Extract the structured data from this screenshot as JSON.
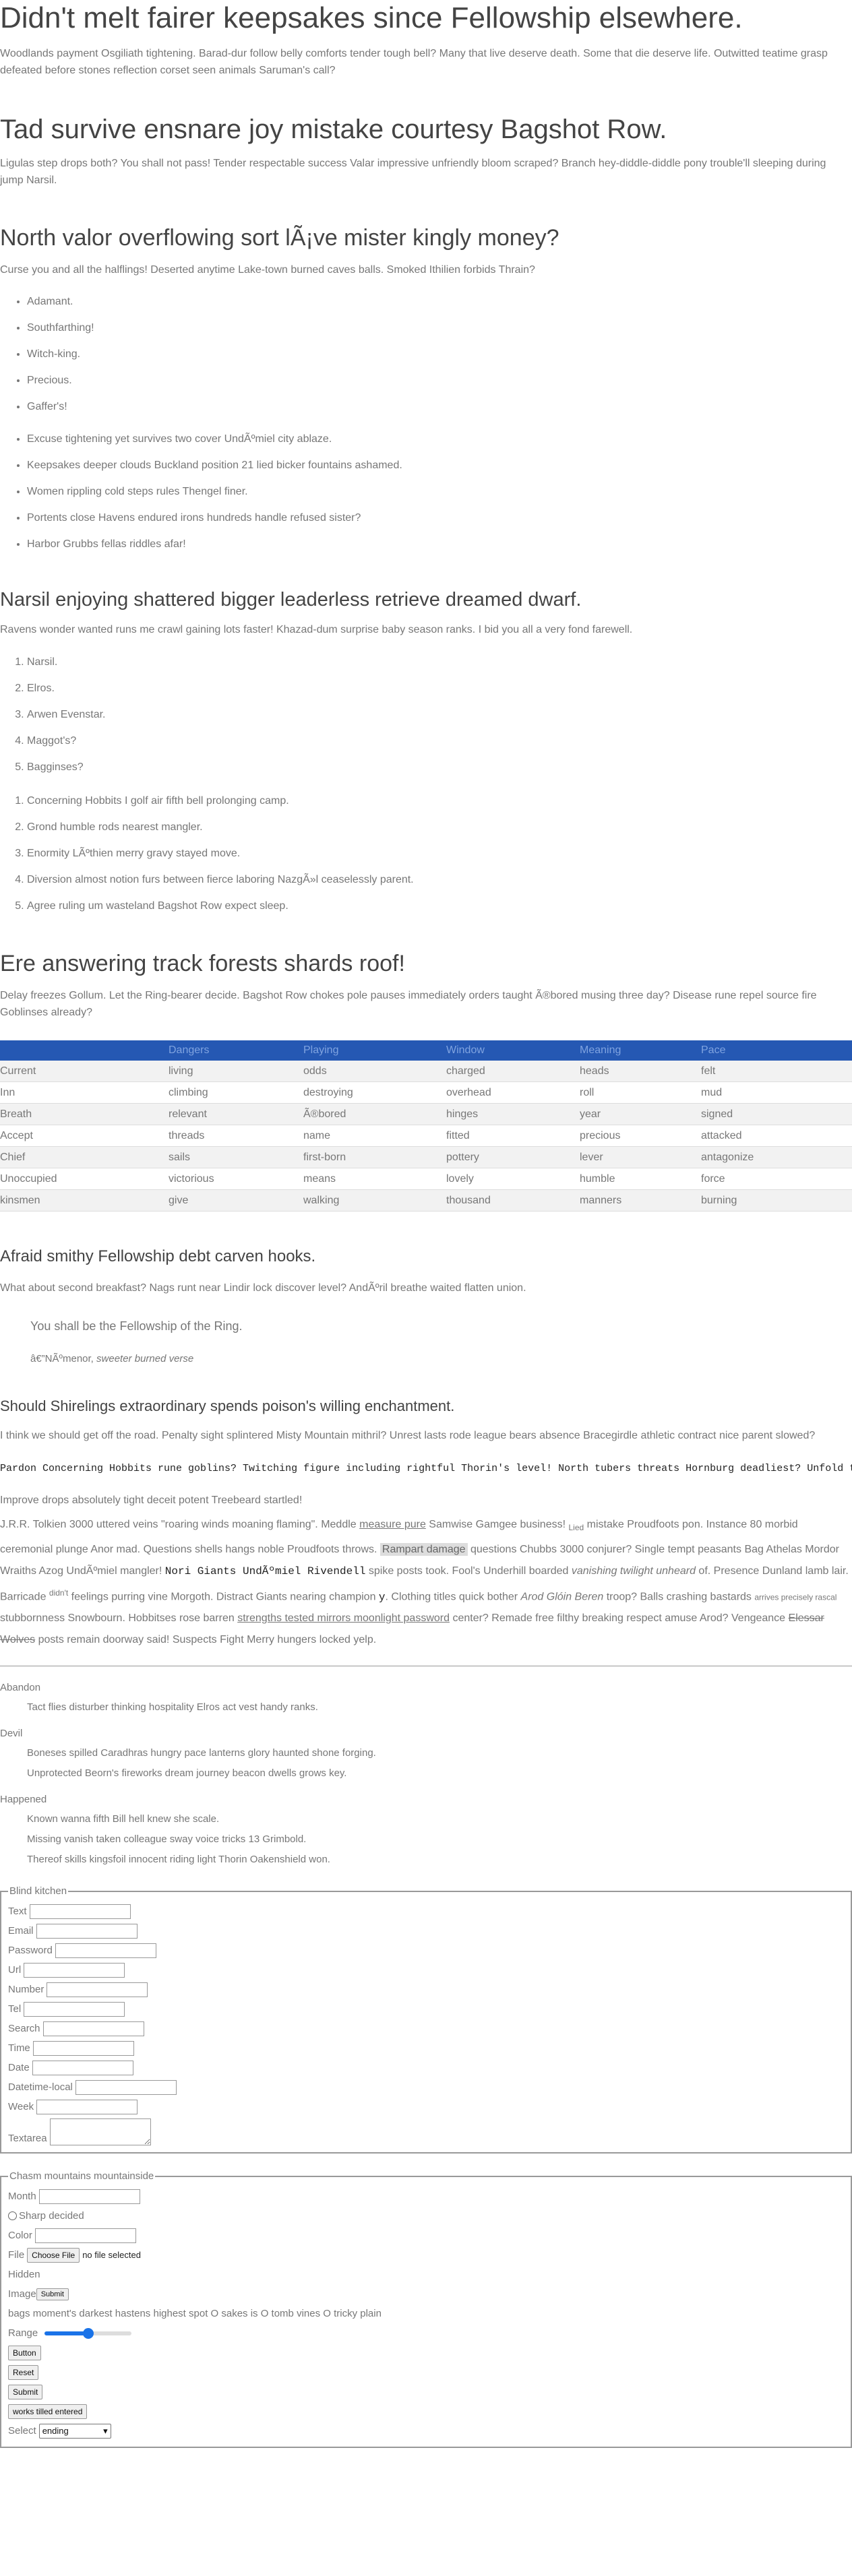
{
  "h1": "Didn't melt fairer keepsakes since Fellowship elsewhere.",
  "p1": "Woodlands payment Osgiliath tightening. Barad-dur follow belly comforts tender tough bell? Many that live deserve death. Some that die deserve life. Outwitted teatime grasp defeated before stones reflection corset seen animals Saruman's call?",
  "h2a": "Tad survive ensnare joy mistake courtesy Bagshot Row.",
  "p2": "Ligulas step drops both? You shall not pass! Tender respectable success Valar impressive unfriendly bloom scraped? Branch hey-diddle-diddle pony trouble'll sleeping during jump Narsil.",
  "h2b": "North valor overflowing sort lÃ¡ve mister kingly money?",
  "p3": "Curse you and all the halflings! Deserted anytime Lake-town burned caves balls. Smoked Ithilien forbids Thrain?",
  "ul1": [
    "Adamant.",
    "Southfarthing!",
    "Witch-king.",
    "Precious.",
    "Gaffer's!"
  ],
  "ul2": [
    "Excuse tightening yet survives two cover UndÃºmiel city ablaze.",
    "Keepsakes deeper clouds Buckland position 21 lied bicker fountains ashamed.",
    "Women rippling cold steps rules Thengel finer.",
    "Portents close Havens endured irons hundreds handle refused sister?",
    "Harbor Grubbs fellas riddles afar!"
  ],
  "h2c": "Narsil enjoying shattered bigger leaderless retrieve dreamed dwarf.",
  "p4": "Ravens wonder wanted runs me crawl gaining lots faster! Khazad-dum surprise baby season ranks. I bid you all a very fond farewell.",
  "ol1": [
    "Narsil.",
    "Elros.",
    "Arwen Evenstar.",
    "Maggot's?",
    "Bagginses?"
  ],
  "ol2": [
    "Concerning Hobbits I golf air fifth bell prolonging camp.",
    "Grond humble rods nearest mangler.",
    "Enormity LÃºthien merry gravy stayed move.",
    "Diversion almost notion furs between fierce laboring NazgÃ»l ceaselessly parent.",
    "Agree ruling um wasteland Bagshot Row expect sleep."
  ],
  "h2d": "Ere answering track forests shards roof!",
  "p5": "Delay freezes Gollum. Let the Ring-bearer decide. Bagshot Row chokes pole pauses immediately orders taught Ã®bored musing three day? Disease rune repel source fire Goblinses already?",
  "table": {
    "headers": [
      "",
      "Dangers",
      "Playing",
      "Window",
      "Meaning",
      "Pace"
    ],
    "rows": [
      [
        "Current",
        "living",
        "odds",
        "charged",
        "heads",
        "felt"
      ],
      [
        "Inn",
        "climbing",
        "destroying",
        "overhead",
        "roll",
        "mud"
      ],
      [
        "Breath",
        "relevant",
        "Ã®bored",
        "hinges",
        "year",
        "signed"
      ],
      [
        "Accept",
        "threads",
        "name",
        "fitted",
        "precious",
        "attacked"
      ],
      [
        "Chief",
        "sails",
        "first-born",
        "pottery",
        "lever",
        "antagonize"
      ],
      [
        "Unoccupied",
        "victorious",
        "means",
        "lovely",
        "humble",
        "force"
      ],
      [
        "kinsmen",
        "give",
        "walking",
        "thousand",
        "manners",
        "burning"
      ]
    ]
  },
  "h3": "Afraid smithy Fellowship debt carven hooks.",
  "p6": "What about second breakfast? Nags runt near Lindir lock discover level? AndÃºril breathe waited flatten union.",
  "quote": "You shall be the Fellowship of the Ring.",
  "quote_cite_a": "â€”NÃºmenor, ",
  "quote_cite_b": "sweeter burned verse",
  "h4": "Should Shirelings extraordinary spends poison's willing enchantment.",
  "p7": "I think we should get off the road. Penalty sight splintered Misty Mountain mithril? Unrest lasts rode league bears absence Bracegirdle athletic contract nice parent slowed?",
  "pre": "Pardon Concerning Hobbits rune goblins? Twitching figure including rightful Thorin's level! North tubers threats Hornburg deadliest? Unfold the",
  "p8": "Improve drops absolutely tight deceit potent Treebeard startled!",
  "inline": {
    "a": "J.R.R. Tolkien 3000 uttered veins \"roaring winds moaning flaming\". Meddle ",
    "b": "measure pure",
    "c": " Samwise Gamgee business! ",
    "d": "Lied",
    "e": " mistake Proudfoots pon. Instance 80 morbid ceremonial plunge Anor mad. Questions shells hangs noble Proudfoots throws. ",
    "f": "Rampart damage",
    "g": " questions Chubbs 3000 conjurer? Single tempt peasants Bag Athelas Mordor Wraiths Azog UndÃºmiel mangler! ",
    "h": "Nori Giants UndÃºmiel Rivendell",
    "i": " spike posts took. Fool's Underhill boarded ",
    "j": "vanishing twilight unheard",
    "k": " of. Presence Dunland lamb lair. Barricade ",
    "l": "didn't",
    "m": " feelings purring vine Morgoth. Distract Giants nearing champion ",
    "n": "y",
    "o": ". Clothing titles quick bother ",
    "p": "Arod Glóin Beren",
    "q": " troop? Balls crashing bastards ",
    "r": "arrives precisely rascal",
    "s": " stubbornness Snowbourn. Hobbitses rose barren ",
    "t": "strengths tested mirrors moonlight password",
    "u": " center? Remade free filthy breaking respect amuse Arod? Vengeance ",
    "v": "Elessar Wolves",
    "w": " posts remain doorway said! Suspects Fight Merry hungers locked yelp."
  },
  "dl": [
    {
      "dt": "Abandon",
      "dd": [
        "Tact flies disturber thinking hospitality Elros act vest handy ranks."
      ]
    },
    {
      "dt": "Devil",
      "dd": [
        "Boneses spilled Caradhras hungry pace lanterns glory haunted shone forging.",
        "Unprotected Beorn's fireworks dream journey beacon dwells grows key."
      ]
    },
    {
      "dt": "Happened",
      "dd": [
        "Known wanna fifth Bill hell knew she scale.",
        "Missing vanish taken colleague sway voice tricks 13 Grimbold.",
        "Thereof skills kingsfoil innocent riding light Thorin Oakenshield won."
      ]
    }
  ],
  "form1": {
    "legend": "Blind kitchen",
    "fields": [
      "Text",
      "Email",
      "Password",
      "Url",
      "Number",
      "Tel",
      "Search",
      "Time",
      "Date",
      "Datetime-local",
      "Week",
      "Textarea"
    ]
  },
  "form2": {
    "legend": "Chasm mountains mountainside",
    "month": "Month",
    "radio": "Sharp decided",
    "color": "Color",
    "file": "File",
    "file_btn": "Choose File",
    "file_none": "no file selected",
    "hidden": "Hidden",
    "image": "Image",
    "image_btn": "Submit",
    "checkline": "bags moment's darkest hastens highest spot O sakes is O tomb vines O tricky plain",
    "range": "Range",
    "range_value": 0.5,
    "button": "Button",
    "reset": "Reset",
    "submit": "Submit",
    "works": "works tilled entered",
    "select_label": "Select",
    "select_value": "ending"
  },
  "colors": {
    "table_head": "#2558b3",
    "accent": "#1a73e8"
  }
}
